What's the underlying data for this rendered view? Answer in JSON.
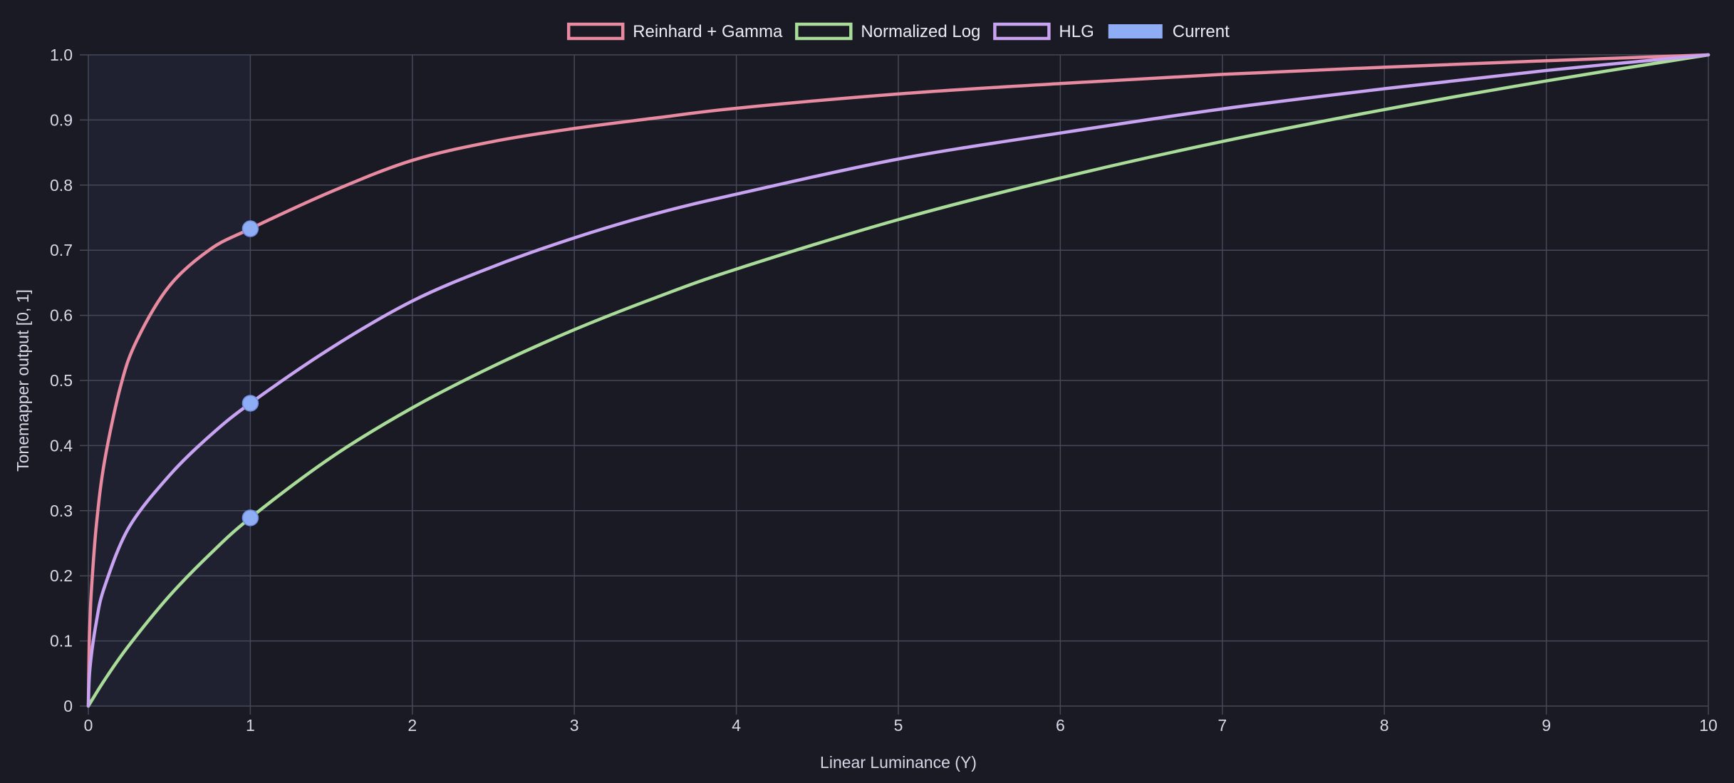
{
  "chart_data": {
    "type": "line",
    "xlabel": "Linear Luminance (Y)",
    "ylabel": "Tonemapper output [0, 1]",
    "xlim": [
      0,
      10
    ],
    "ylim": [
      0,
      1
    ],
    "x_ticks": [
      "0",
      "1",
      "2",
      "3",
      "4",
      "5",
      "6",
      "7",
      "8",
      "9",
      "10"
    ],
    "y_ticks": [
      "0",
      "0.1",
      "0.2",
      "0.3",
      "0.4",
      "0.5",
      "0.6",
      "0.7",
      "0.8",
      "0.9",
      "1.0"
    ],
    "grid": true,
    "legend_position": "top-center",
    "shaded_region": {
      "x": [
        0,
        1
      ],
      "color": "#1f2130"
    },
    "legend": [
      {
        "label": "Reinhard + Gamma",
        "color": "#e88aa0",
        "style": "outline"
      },
      {
        "label": "Normalized Log",
        "color": "#a8dc98",
        "style": "outline"
      },
      {
        "label": "HLG",
        "color": "#c7a3f2",
        "style": "outline"
      },
      {
        "label": "Current",
        "color": "#8eadf5",
        "style": "filled"
      }
    ],
    "series": [
      {
        "name": "Reinhard + Gamma",
        "color": "#e88aa0",
        "x": [
          0,
          0.005,
          0.01,
          0.02,
          0.05,
          0.1,
          0.2,
          0.3,
          0.5,
          0.75,
          1,
          1.5,
          2,
          2.5,
          3,
          3.5,
          4,
          5,
          6,
          7,
          8,
          9,
          10
        ],
        "y": [
          0,
          0.092,
          0.13,
          0.182,
          0.279,
          0.376,
          0.492,
          0.562,
          0.645,
          0.701,
          0.733,
          0.79,
          0.838,
          0.867,
          0.887,
          0.903,
          0.918,
          0.94,
          0.956,
          0.97,
          0.981,
          0.991,
          1.0
        ]
      },
      {
        "name": "Normalized Log",
        "color": "#a8dc98",
        "x": [
          0,
          0.1,
          0.25,
          0.5,
          0.75,
          1,
          1.5,
          2,
          2.5,
          3,
          3.5,
          4,
          5,
          6,
          7,
          8,
          9,
          10
        ],
        "y": [
          0,
          0.04,
          0.093,
          0.169,
          0.233,
          0.289,
          0.382,
          0.458,
          0.522,
          0.578,
          0.627,
          0.671,
          0.747,
          0.811,
          0.867,
          0.916,
          0.96,
          1.0
        ]
      },
      {
        "name": "HLG",
        "color": "#c7a3f2",
        "x": [
          0,
          0.01,
          0.05,
          0.1,
          0.25,
          0.5,
          0.75,
          1,
          1.5,
          2,
          2.5,
          3,
          3.5,
          4,
          5,
          6,
          7,
          8,
          9,
          10
        ],
        "y": [
          0,
          0.058,
          0.13,
          0.183,
          0.274,
          0.354,
          0.415,
          0.465,
          0.55,
          0.622,
          0.675,
          0.719,
          0.756,
          0.786,
          0.84,
          0.88,
          0.917,
          0.948,
          0.976,
          1.0
        ]
      }
    ],
    "current_points": [
      {
        "series": "Reinhard + Gamma",
        "x": 1,
        "y": 0.733
      },
      {
        "series": "HLG",
        "x": 1,
        "y": 0.465
      },
      {
        "series": "Normalized Log",
        "x": 1,
        "y": 0.289
      }
    ],
    "current_color": "#8eadf5"
  }
}
